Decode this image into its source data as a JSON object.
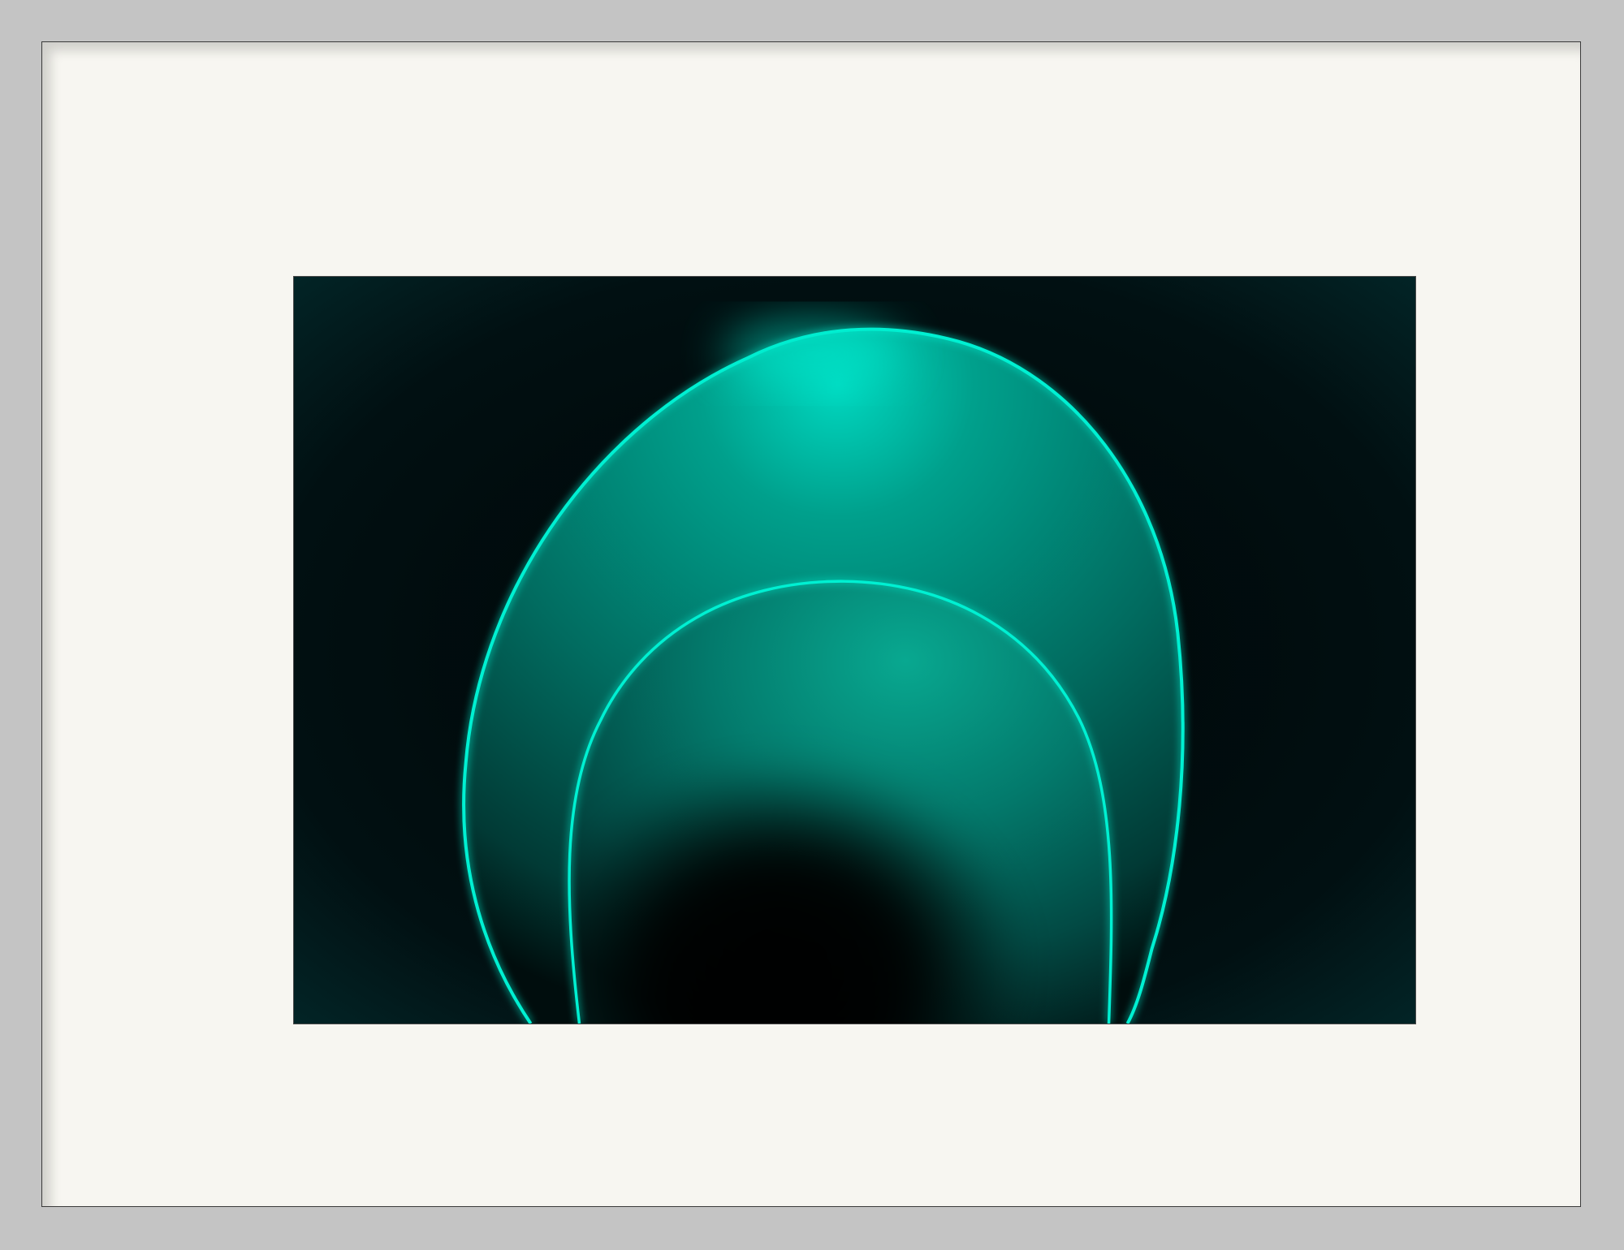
{
  "artwork": {
    "subject": "abstract",
    "colors": {
      "background": "#01090a",
      "glow": "#00e5c8",
      "fill_light": "#0a9a86",
      "fill_dark": "#014a44",
      "shadow": "#000303",
      "mat": "#f7f6f1",
      "frame": "#c4c4c4"
    }
  }
}
